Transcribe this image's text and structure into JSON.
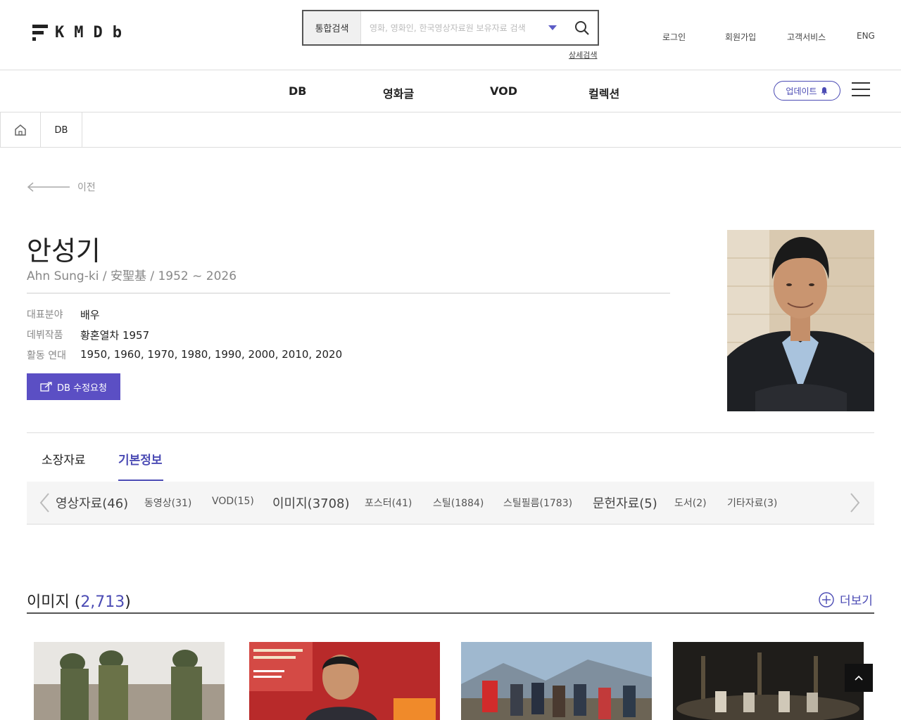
{
  "header": {
    "logo_text": "KMDb",
    "search": {
      "type_label": "통합검색",
      "placeholder": "영화, 영화인, 한국영상자료원 보유자료 검색",
      "advanced_label": "상세검색"
    },
    "util_links": [
      "로그인",
      "회원가입",
      "고객서비스",
      "ENG"
    ]
  },
  "gnb": {
    "items": [
      "DB",
      "영화글",
      "VOD",
      "컬렉션"
    ],
    "update_label": "업데이트"
  },
  "breadcrumb": {
    "items": [
      "DB"
    ]
  },
  "back_label": "이전",
  "person": {
    "name": "안성기",
    "sub": "Ahn Sung-ki / 安聖基 / 1952 ~ 2026",
    "info": [
      {
        "label": "대표분야",
        "value": "배우"
      },
      {
        "label": "데뷔작품",
        "value": "황혼열차 1957"
      },
      {
        "label": "활동 연대",
        "value": "1950, 1960, 1970, 1980, 1990, 2000, 2010, 2020"
      }
    ],
    "db_request_label": "DB 수정요청"
  },
  "tabs": [
    "소장자료",
    "기본정보"
  ],
  "sub_tabs": [
    "영상자료(46)",
    "동영상(31)",
    "VOD(15)",
    "이미지(3708)",
    "포스터(41)",
    "스틸(1884)",
    "스틸필름(1783)",
    "문헌자료(5)",
    "도서(2)",
    "기타자료(3)"
  ],
  "image_section": {
    "title": "이미지",
    "count": "2,713",
    "more_label": "더보기"
  },
  "colors": {
    "accent": "#4b4bb4",
    "button": "#5b4fc4"
  }
}
